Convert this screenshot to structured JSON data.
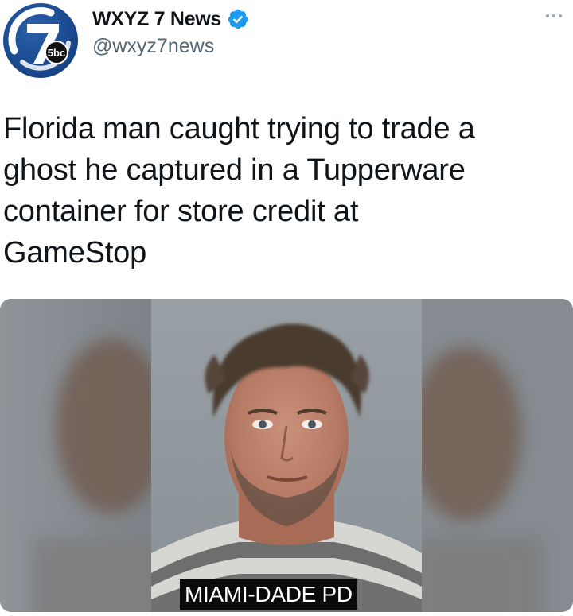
{
  "author": {
    "display_name": "WXYZ 7 News",
    "handle": "@wxyz7news",
    "verified": true,
    "avatar": {
      "icon": "channel-7-abc-logo",
      "number": "7",
      "network": "5bc"
    }
  },
  "tweet": {
    "text": "Florida man caught trying to trade a\nghost he captured in a Tupperware\ncontainer for store credit at\nGameStop"
  },
  "media": {
    "type": "photo",
    "subject": "mugshot",
    "caption": "MIAMI-DADE PD"
  },
  "icons": {
    "verified": "verified-badge-icon",
    "more": "more-options-icon"
  },
  "colors": {
    "verified_blue": "#1d9bf0",
    "avatar_blue": "#1b4a8f",
    "handle_gray": "#536471",
    "text": "#0f1419"
  }
}
